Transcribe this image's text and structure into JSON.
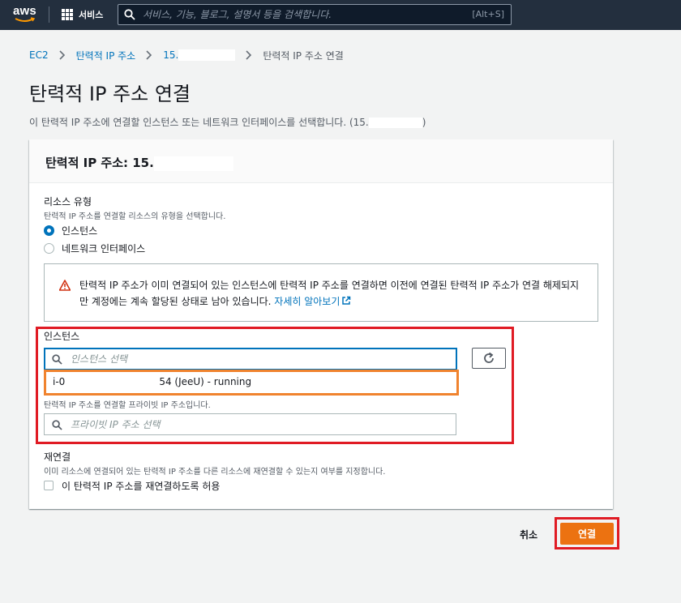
{
  "nav": {
    "logo_text": "aws",
    "services_label": "서비스",
    "search_placeholder": "서비스, 기능, 블로그, 설명서 등을 검색합니다.",
    "search_shortcut": "[Alt+S]"
  },
  "breadcrumb": {
    "items": [
      "EC2",
      "탄력적 IP 주소",
      "15."
    ],
    "current": "탄력적 IP 주소 연결"
  },
  "page": {
    "title": "탄력적 IP 주소 연결",
    "description_prefix": "이 탄력적 IP 주소에 연결할 인스턴스 또는 네트워크 인터페이스를 선택합니다. (15.",
    "description_suffix": ")"
  },
  "panel": {
    "title_prefix": "탄력적 IP 주소: 15.",
    "resource_type": {
      "label": "리소스 유형",
      "description": "탄력적 IP 주소를 연결할 리소스의 유형을 선택합니다.",
      "options": [
        "인스턴스",
        "네트워크 인터페이스"
      ],
      "selected": "인스턴스"
    },
    "warning": {
      "text": "탄력적 IP 주소가 이미 연결되어 있는 인스턴스에 탄력적 IP 주소를 연결하면 이전에 연결된 탄력적 IP 주소가 연결 해제되지만 계정에는 계속 할당된 상태로 남아 있습니다.",
      "link_text": "자세히 알아보기"
    },
    "instance": {
      "label": "인스턴스",
      "placeholder": "인스턴스 선택",
      "option_prefix": "i-0",
      "option_suffix": "54 (JeeU) - running"
    },
    "private_ip": {
      "description": "탄력적 IP 주소를 연결할 프라이빗 IP 주소입니다.",
      "placeholder": "프라이빗 IP 주소 선택"
    },
    "reassociation": {
      "label": "재연결",
      "description": "이미 리소스에 연결되어 있는 탄력적 IP 주소를 다른 리소스에 재연결할 수 있는지 여부를 지정합니다.",
      "checkbox_label": "이 탄력적 IP 주소를 재연결하도록 허용"
    }
  },
  "actions": {
    "cancel_label": "취소",
    "connect_label": "연결"
  },
  "colors": {
    "nav_bg": "#232f3e",
    "link": "#0073bb",
    "primary_button": "#ec7211",
    "highlight_red": "#e01b24",
    "highlight_orange": "#f0832e"
  }
}
